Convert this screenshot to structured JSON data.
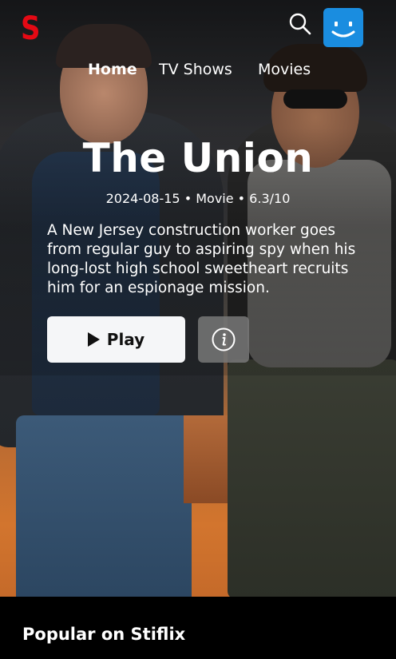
{
  "app": {
    "logo_letter": "S",
    "brand_color": "#e50914",
    "avatar_color": "#1a8de0"
  },
  "header": {
    "search_icon": "search-icon",
    "avatar_icon": "smiley-avatar-icon"
  },
  "nav": {
    "tabs": [
      {
        "label": "Home",
        "active": true
      },
      {
        "label": "TV Shows",
        "active": false
      },
      {
        "label": "Movies",
        "active": false
      }
    ]
  },
  "hero": {
    "title": "The Union",
    "meta": "2024-08-15 • Movie • 6.3/10",
    "description": "A New Jersey construction worker goes from regular guy to aspiring spy when his long-lost high school sweetheart recruits him for an espionage mission.",
    "play_label": "Play",
    "info_icon": "info-icon",
    "play_icon": "play-icon"
  },
  "row": {
    "title": "Popular on Stiflix"
  }
}
